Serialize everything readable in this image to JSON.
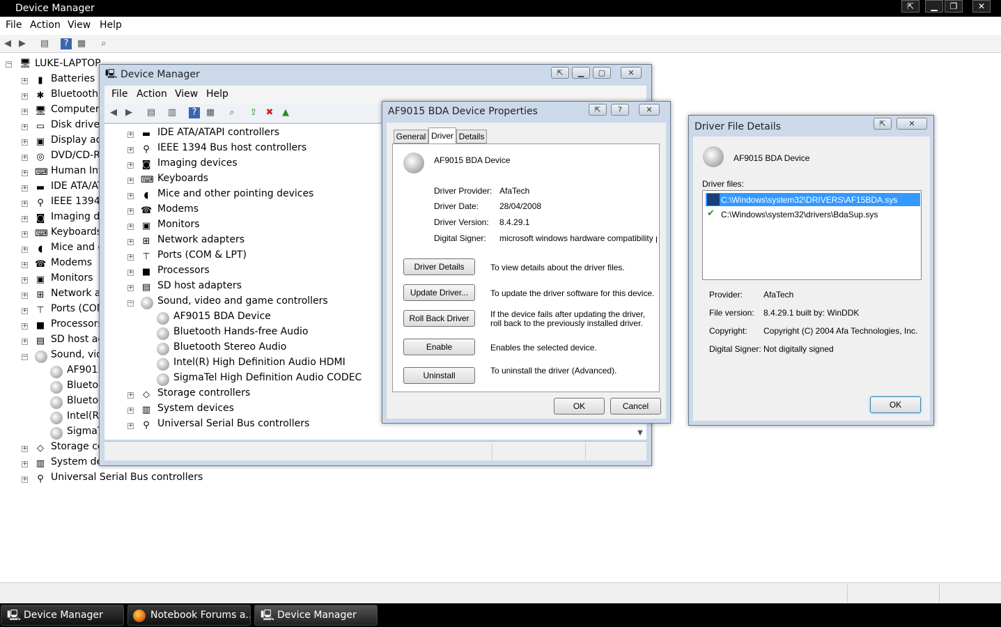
{
  "main": {
    "title": "Device Manager",
    "menu": [
      "File",
      "Action",
      "View",
      "Help"
    ],
    "root": "LUKE-LAPTOP",
    "tree": [
      {
        "label": "Batteries",
        "icon": "battery-icon"
      },
      {
        "label": "Bluetooth R",
        "icon": "bluetooth-icon"
      },
      {
        "label": "Computer",
        "icon": "computer-icon"
      },
      {
        "label": "Disk drives",
        "icon": "disk-icon"
      },
      {
        "label": "Display ada",
        "icon": "display-icon"
      },
      {
        "label": "DVD/CD-R",
        "icon": "dvd-icon"
      },
      {
        "label": "Human Inte",
        "icon": "hid-icon"
      },
      {
        "label": "IDE ATA/AT",
        "icon": "ide-icon"
      },
      {
        "label": "IEEE 1394 B",
        "icon": "ieee-icon"
      },
      {
        "label": "Imaging de",
        "icon": "camera-icon"
      },
      {
        "label": "Keyboards",
        "icon": "keyboard-icon"
      },
      {
        "label": "Mice and o",
        "icon": "mouse-icon"
      },
      {
        "label": "Modems",
        "icon": "modem-icon"
      },
      {
        "label": "Monitors",
        "icon": "monitor-icon"
      },
      {
        "label": "Network ad",
        "icon": "network-icon"
      },
      {
        "label": "Ports (COM",
        "icon": "port-icon"
      },
      {
        "label": "Processors",
        "icon": "cpu-icon"
      },
      {
        "label": "SD host ad",
        "icon": "sd-icon"
      },
      {
        "label": "Sound, vide",
        "icon": "speaker-icon"
      },
      {
        "label": "AF9015",
        "icon": "speaker-icon"
      },
      {
        "label": "Bluetoo",
        "icon": "speaker-icon"
      },
      {
        "label": "Bluetoo",
        "icon": "speaker-icon"
      },
      {
        "label": "Intel(R)",
        "icon": "speaker-icon"
      },
      {
        "label": "SigmaT",
        "icon": "speaker-icon"
      },
      {
        "label": "Storage co",
        "icon": "storage-icon"
      },
      {
        "label": "System dev",
        "icon": "system-icon"
      },
      {
        "label": "Universal Serial Bus controllers",
        "icon": "usb-icon"
      }
    ]
  },
  "dm2": {
    "title": "Device Manager",
    "menu": [
      "File",
      "Action",
      "View",
      "Help"
    ],
    "tree": [
      "IDE ATA/ATAPI controllers",
      "IEEE 1394 Bus host controllers",
      "Imaging devices",
      "Keyboards",
      "Mice and other pointing devices",
      "Modems",
      "Monitors",
      "Network adapters",
      "Ports (COM & LPT)",
      "Processors",
      "SD host adapters",
      "Sound, video and game controllers",
      "AF9015 BDA Device",
      "Bluetooth Hands-free Audio",
      "Bluetooth Stereo Audio",
      "Intel(R) High Definition Audio HDMI",
      "SigmaTel High Definition Audio CODEC",
      "Storage controllers",
      "System devices",
      "Universal Serial Bus controllers"
    ]
  },
  "props": {
    "title": "AF9015 BDA Device Properties",
    "tabs": [
      "General",
      "Driver",
      "Details"
    ],
    "device": "AF9015 BDA Device",
    "provider_label": "Driver Provider:",
    "provider": "AfaTech",
    "date_label": "Driver Date:",
    "date": "28/04/2008",
    "version_label": "Driver Version:",
    "version": "8.4.29.1",
    "signer_label": "Digital Signer:",
    "signer": "microsoft windows hardware compatibility publisher",
    "buttons": [
      {
        "label": "Driver Details",
        "desc": "To view details about the driver files."
      },
      {
        "label": "Update Driver...",
        "desc": "To update the driver software for this device."
      },
      {
        "label": "Roll Back Driver",
        "desc": "If the device fails after updating the driver, roll back to the previously installed driver."
      },
      {
        "label": "Enable",
        "desc": "Enables the selected device."
      },
      {
        "label": "Uninstall",
        "desc": "To uninstall the driver (Advanced)."
      }
    ],
    "ok": "OK",
    "cancel": "Cancel"
  },
  "details": {
    "title": "Driver File Details",
    "device": "AF9015 BDA Device",
    "files_label": "Driver files:",
    "files": [
      "C:\\Windows\\system32\\DRIVERS\\AF15BDA.sys",
      "C:\\Windows\\system32\\drivers\\BdaSup.sys"
    ],
    "provider_label": "Provider:",
    "provider": "AfaTech",
    "fileversion_label": "File version:",
    "fileversion": "8.4.29.1  built by: WinDDK",
    "copyright_label": "Copyright:",
    "copyright": "Copyright (C) 2004 Afa Technologies, Inc.",
    "signer_label": "Digital Signer:",
    "signer": "Not digitally signed",
    "ok": "OK"
  },
  "taskbar": [
    "Device Manager",
    "Notebook Forums a...",
    "Device Manager"
  ]
}
